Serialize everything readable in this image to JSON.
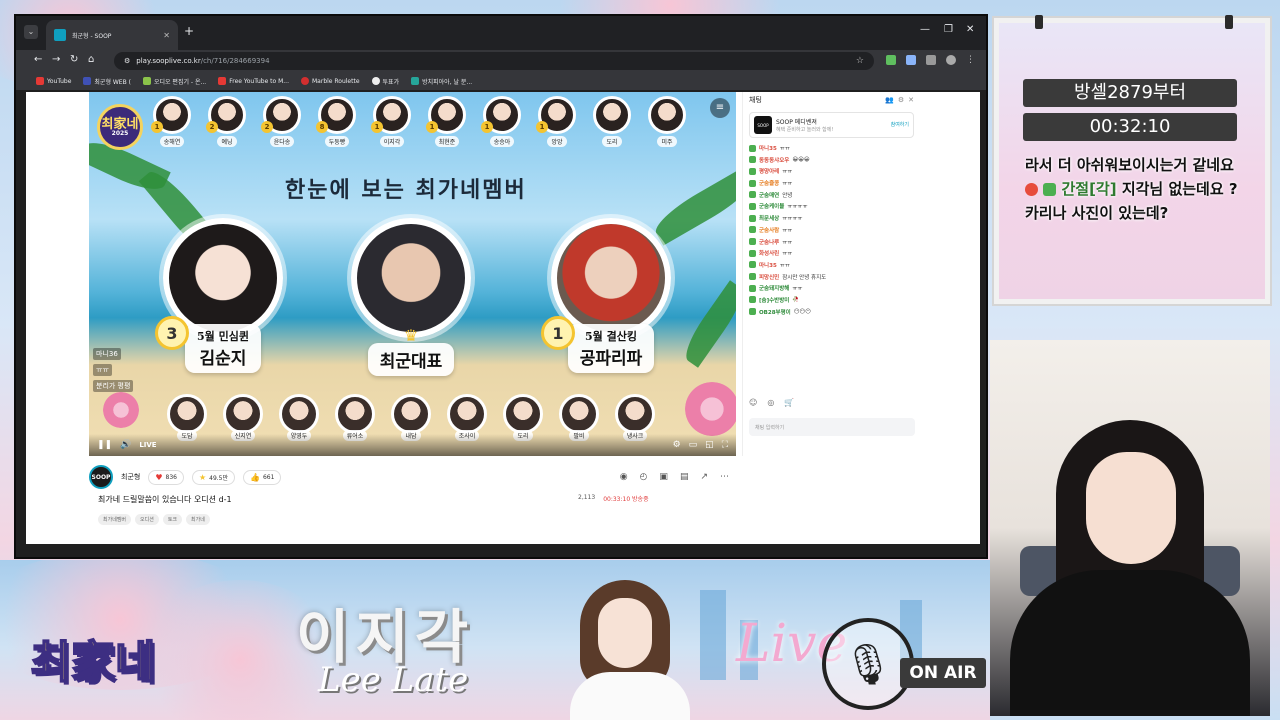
{
  "browser": {
    "tab_title": "최군형 - SOOP",
    "new_tab": "+",
    "url_host": "play.sooplive.co.kr",
    "url_path": "/ch/716/284669394",
    "bookmarks": [
      "YouTube",
      "최군형 WEB (",
      "오디오 편집기 - 온...",
      "Free YouTube to M...",
      "Marble Roulette",
      "투표가",
      "방치피아아, 날 분..."
    ],
    "window_controls": [
      "—",
      "❐",
      "✕"
    ]
  },
  "video": {
    "logo_text": "최家네",
    "logo_year": "2025",
    "headline": "한눈에 보는 최가네멤버",
    "top_members": [
      {
        "name": "송해연",
        "rank": "1"
      },
      {
        "name": "예닝",
        "rank": "2"
      },
      {
        "name": "윤다송",
        "rank": "2"
      },
      {
        "name": "두둥빵",
        "rank": "8"
      },
      {
        "name": "이지각",
        "rank": "1"
      },
      {
        "name": "최현준",
        "rank": "1"
      },
      {
        "name": "송승아",
        "rank": "1"
      },
      {
        "name": "앙앙",
        "rank": "1"
      },
      {
        "name": "도리",
        "rank": ""
      },
      {
        "name": "미주",
        "rank": ""
      }
    ],
    "featured": [
      {
        "rank": "3",
        "line1": "5월 민심퀸",
        "line2": "김순지"
      },
      {
        "rank": "",
        "line1": "",
        "line2": "최군대표"
      },
      {
        "rank": "1",
        "line1": "5월 결산킹",
        "line2": "공파리파"
      }
    ],
    "bottom_members": [
      "도담",
      "신지연",
      "양영두",
      "류어소",
      "내담",
      "조사이",
      "도리",
      "팔비",
      "냉사크"
    ],
    "overlay_chat": [
      "마니36",
      "ㅠㅠ",
      "분리가 평평"
    ],
    "live_label": "LIVE"
  },
  "info": {
    "streamer": "최군형",
    "avatar_text": "SOOP",
    "stats": [
      {
        "icon": "♥",
        "value": "836"
      },
      {
        "icon": "★",
        "value": "49.5만"
      },
      {
        "icon": "👍",
        "value": "661"
      }
    ],
    "title": "최가네 드릴말씀이 있습니다 오디션 d-1",
    "viewers": "2,113",
    "elapsed": "00:33:10 방송중",
    "tags": [
      "최가네멤버",
      "오디션",
      "토크",
      "최가네"
    ]
  },
  "chat": {
    "title": "채팅",
    "ad_title": "SOOP 메디벤져",
    "ad_sub": "혜택 준비하고 놀러와 함께!",
    "ad_link": "참여하기",
    "messages": [
      {
        "user": "마니35",
        "text": "ㅠㅠ",
        "color": "#d94c3d"
      },
      {
        "user": "동동동샤오우",
        "text": "😀😀😀",
        "color": "#d94c3d"
      },
      {
        "user": "평양아레",
        "text": "ㅠㅠ",
        "color": "#d94c3d"
      },
      {
        "user": "군숨줄콩",
        "text": "ㅠㅠ",
        "color": "#e67e22"
      },
      {
        "user": "군숨매연",
        "text": "안녕",
        "color": "#2e8b3a"
      },
      {
        "user": "군숨케이블",
        "text": "ㅠㅠㅠㅠ",
        "color": "#2e8b3a"
      },
      {
        "user": "최문세상",
        "text": "ㅠㅠㅠㅠ",
        "color": "#2e8b3a"
      },
      {
        "user": "군숨사람",
        "text": "ㅠㅠ",
        "color": "#e67e22"
      },
      {
        "user": "군숨나루",
        "text": "ㅠㅠ",
        "color": "#d94c3d"
      },
      {
        "user": "화성사린",
        "text": "ㅠㅠ",
        "color": "#d94c3d"
      },
      {
        "user": "마니35",
        "text": "ㅠㅠ",
        "color": "#d94c3d"
      },
      {
        "user": "피망신민",
        "text": "잠시만 안녕 휴지도",
        "color": "#d94c3d"
      },
      {
        "user": "군숨돼지방해",
        "text": "ㅠㅠ",
        "color": "#2e8b3a"
      },
      {
        "user": "[숨]수반방미",
        "text": "🥀",
        "color": "#2e8b3a"
      },
      {
        "user": "OB28부평이",
        "text": "😶😶😶",
        "color": "#2e8b3a"
      }
    ],
    "input_placeholder": "채팅 입력하기"
  },
  "timer": {
    "line1": "방셀2879부터",
    "line2": "00:32:10",
    "chat_line1": "라서 더 아쉬워보이시는거 같네요",
    "chat_user": "간절[각]",
    "chat_line2": "지각님 없는데요 ? 카리나 사진이 있는데?"
  },
  "banner": {
    "name_ko": "이지각",
    "name_en": "Lee Late",
    "logo": "최家네",
    "live": "Live",
    "on_air": "ON AIR"
  }
}
